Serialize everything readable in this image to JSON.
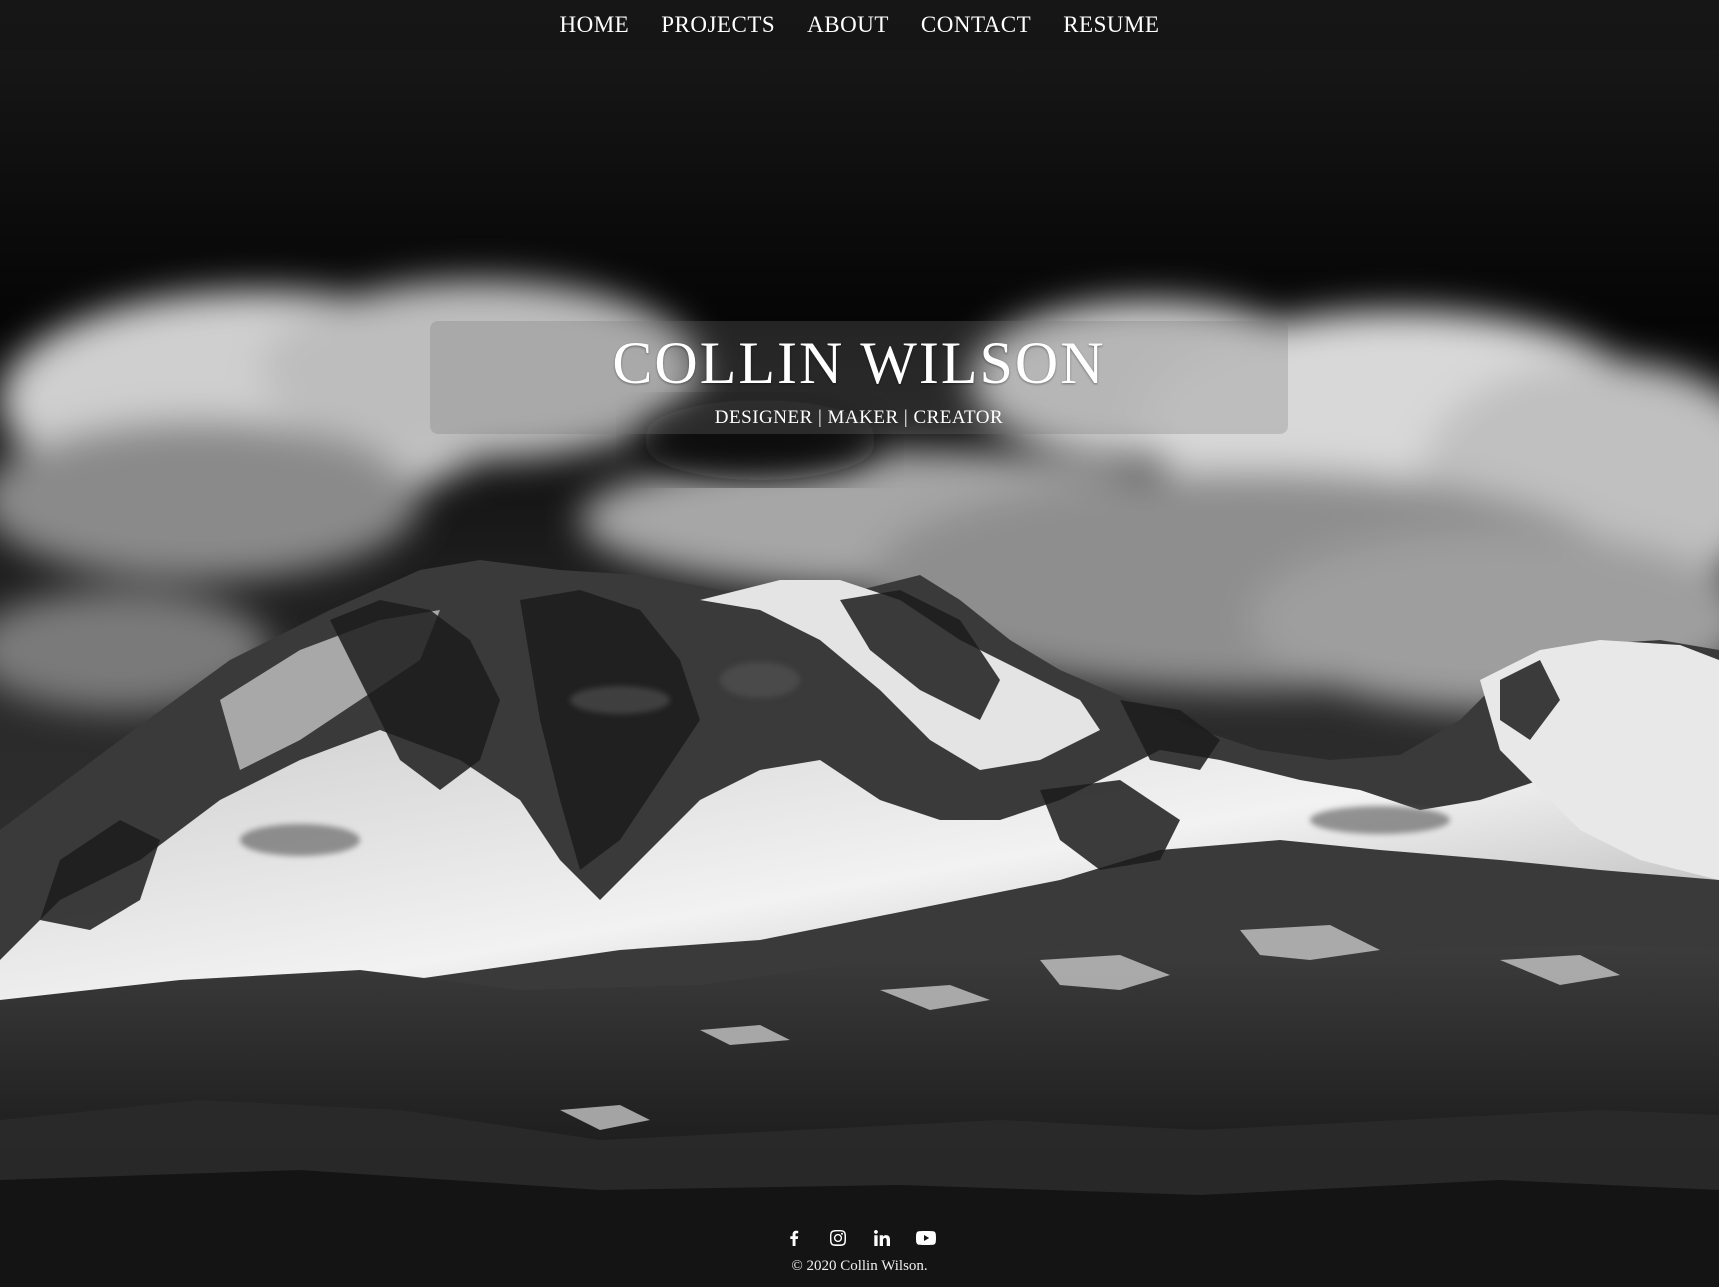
{
  "nav": {
    "items": [
      {
        "label": "HOME"
      },
      {
        "label": "PROJECTS"
      },
      {
        "label": "ABOUT"
      },
      {
        "label": "CONTACT"
      },
      {
        "label": "RESUME"
      }
    ]
  },
  "hero": {
    "title": "COLLIN WILSON",
    "tagline": "DESIGNER | MAKER | CREATOR",
    "background": "black-and-white-snowy-mountain-under-clouds"
  },
  "footer": {
    "social": [
      {
        "icon": "facebook-icon"
      },
      {
        "icon": "instagram-icon"
      },
      {
        "icon": "linkedin-icon"
      },
      {
        "icon": "youtube-icon"
      }
    ],
    "copyright": "© 2020 Collin Wilson."
  },
  "colors": {
    "text": "#ffffff",
    "nav_bg": "#141414",
    "card_bg": "#787878"
  }
}
